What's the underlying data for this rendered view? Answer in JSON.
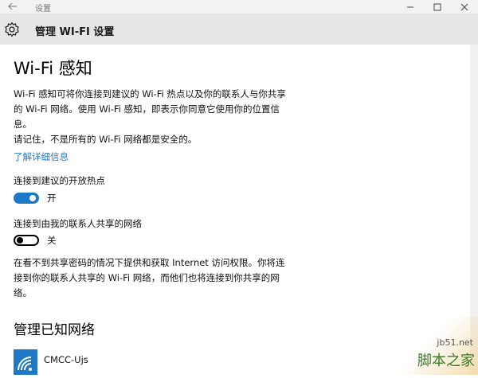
{
  "window": {
    "title": "设置"
  },
  "header": {
    "title": "管理 WI-FI 设置"
  },
  "wifi_sense": {
    "heading": "Wi-Fi 感知",
    "description": "Wi-Fi 感知可将你连接到建议的 Wi-Fi 热点以及你的联系人与你共享的 Wi-Fi 网络。使用 Wi-Fi 感知，即表示你同意它使用你的位置信息。",
    "warning": "请记住，不是所有的 Wi-Fi 网络都是安全的。",
    "learn_more": "了解详细信息",
    "open_hotspots": {
      "label": "连接到建议的开放热点",
      "state": "开",
      "on": true
    },
    "contacts_networks": {
      "label": "连接到由我的联系人共享的网络",
      "state": "关",
      "on": false
    },
    "sharing_note": "在看不到共享密码的情况下提供和获取 Internet 访问权限。你将连接到你的联系人共享的 Wi-Fi 网络，而他们也将连接到你共享的网络。"
  },
  "known_networks": {
    "heading": "管理已知网络",
    "items": [
      {
        "name": "CMCC-Ujs"
      }
    ]
  },
  "watermark": {
    "url": "jb51.net",
    "name": "脚本之家"
  },
  "colors": {
    "accent": "#1e78c8",
    "header_bg": "#e6e6e6",
    "titlebar_bg": "#f2f2f2"
  }
}
